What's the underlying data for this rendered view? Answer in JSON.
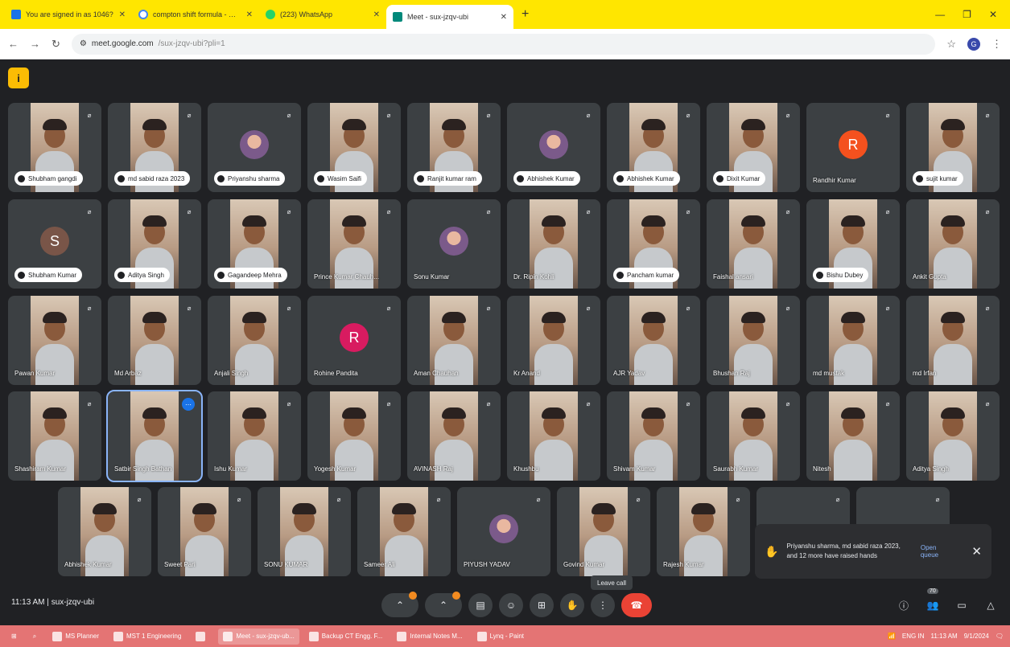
{
  "browser": {
    "tabs": [
      {
        "title": "You are signed in as 1046?",
        "icon": "site-icon"
      },
      {
        "title": "compton shift formula - Goog",
        "icon": "google-icon"
      },
      {
        "title": "(223) WhatsApp",
        "icon": "whatsapp-icon"
      },
      {
        "title": "Meet - sux-jzqv-ubi",
        "icon": "meet-icon",
        "active": true
      }
    ],
    "url_host": "meet.google.com",
    "url_path": "/sux-jzqv-ubi?pli=1",
    "profile_initial": "G"
  },
  "meeting": {
    "info_chip": "i",
    "rows": [
      [
        {
          "name": "Shubham gangdi",
          "type": "video",
          "pill": true
        },
        {
          "name": "md sabid raza 2023",
          "type": "video",
          "pill": true
        },
        {
          "name": "Priyanshu sharma",
          "type": "photo",
          "pill": true
        },
        {
          "name": "Wasim Saifi",
          "type": "video",
          "pill": true
        },
        {
          "name": "Ranjit kumar ram",
          "type": "video",
          "pill": true
        },
        {
          "name": "Abhishek Kumar",
          "type": "photo",
          "pill": true
        },
        {
          "name": "Abhishek Kumar",
          "type": "video",
          "pill": true
        },
        {
          "name": "Dixit Kumar",
          "type": "video",
          "pill": true
        },
        {
          "name": "Randhir Kumar",
          "type": "letter",
          "letter": "R",
          "color": "#f4511e",
          "pill": false
        },
        {
          "name": "sujit kumar",
          "type": "video",
          "pill": true
        }
      ],
      [
        {
          "name": "Shubham Kumar",
          "type": "letter",
          "letter": "S",
          "color": "#795548",
          "pill": true
        },
        {
          "name": "Aditya Singh",
          "type": "video",
          "pill": true
        },
        {
          "name": "Gagandeep Mehra",
          "type": "video",
          "pill": true
        },
        {
          "name": "Prince Kumar Chauh...",
          "type": "video",
          "pill": false
        },
        {
          "name": "Sonu Kumar",
          "type": "photo",
          "pill": false
        },
        {
          "name": "Dr. Ripin Kohli",
          "type": "video",
          "pill": false
        },
        {
          "name": "Pancham kumar",
          "type": "video",
          "pill": true
        },
        {
          "name": "Faishal ansari",
          "type": "video",
          "pill": false
        },
        {
          "name": "Bishu Dubey",
          "type": "video",
          "pill": true
        },
        {
          "name": "Ankit Gupta",
          "type": "video",
          "pill": false
        }
      ],
      [
        {
          "name": "Pawan Kumar",
          "type": "video",
          "pill": false
        },
        {
          "name": "Md Arbaz",
          "type": "video",
          "pill": false
        },
        {
          "name": "Anjali Singh",
          "type": "video",
          "pill": false
        },
        {
          "name": "Rohine Pandita",
          "type": "letter",
          "letter": "R",
          "color": "#d81b60",
          "pill": false
        },
        {
          "name": "Aman Chauhan",
          "type": "video",
          "pill": false
        },
        {
          "name": "Kr Anand",
          "type": "video",
          "pill": false
        },
        {
          "name": "AJR Yadav",
          "type": "video",
          "pill": false
        },
        {
          "name": "Bhushan Raj",
          "type": "video",
          "pill": false
        },
        {
          "name": "md mustak",
          "type": "video",
          "pill": false
        },
        {
          "name": "md Irfan",
          "type": "video",
          "pill": false
        }
      ],
      [
        {
          "name": "Shashiram Kumar",
          "type": "video",
          "pill": false
        },
        {
          "name": "Satbir Singh Bathan",
          "type": "video",
          "pill": false,
          "active": true
        },
        {
          "name": "Ishu Kumar",
          "type": "video",
          "pill": false
        },
        {
          "name": "Yogesh Kumar",
          "type": "video",
          "pill": false
        },
        {
          "name": "AVINASH Raj",
          "type": "video",
          "pill": false
        },
        {
          "name": "Khushbu",
          "type": "video",
          "pill": false
        },
        {
          "name": "Shivam Kumar",
          "type": "video",
          "pill": false
        },
        {
          "name": "Saurabh Kumar",
          "type": "video",
          "pill": false
        },
        {
          "name": "Nitesh",
          "type": "video",
          "pill": false
        },
        {
          "name": "Aditya Singh",
          "type": "video",
          "pill": false
        }
      ],
      [
        {
          "name": "Abhishek Kumar",
          "type": "video",
          "pill": false
        },
        {
          "name": "Sweet Pari",
          "type": "video",
          "pill": false
        },
        {
          "name": "SONU KUMAR",
          "type": "video",
          "pill": false
        },
        {
          "name": "Sameer Ali",
          "type": "video",
          "pill": false
        },
        {
          "name": "PIYUSH YADAV",
          "type": "photo",
          "pill": false
        },
        {
          "name": "Govind Kumar",
          "type": "video",
          "pill": false
        },
        {
          "name": "Rajesh Kumar",
          "type": "video",
          "pill": false
        },
        {
          "name": "",
          "type": "blank",
          "pill": false
        },
        {
          "name": "",
          "type": "blank",
          "pill": false
        }
      ]
    ],
    "raised_hands": {
      "text": "Priyanshu sharma, md sabid raza 2023, and 12 more have raised hands",
      "action": "Open queue"
    },
    "tooltip": "Leave call",
    "time": "11:13 AM",
    "meeting_code": "sux-jzqv-ubi",
    "participant_count": "70"
  },
  "taskbar": {
    "items": [
      {
        "label": "MS Planner"
      },
      {
        "label": "MST 1 Engineering"
      },
      {
        "label": ""
      },
      {
        "label": "Meet - sux-jzqv-ub..."
      },
      {
        "label": "Backup CT Engg. F..."
      },
      {
        "label": "Internal Notes M..."
      },
      {
        "label": "Lynq - Paint"
      }
    ],
    "lang": "ENG IN",
    "clock": "11:13 AM",
    "date": "9/1/2024"
  }
}
